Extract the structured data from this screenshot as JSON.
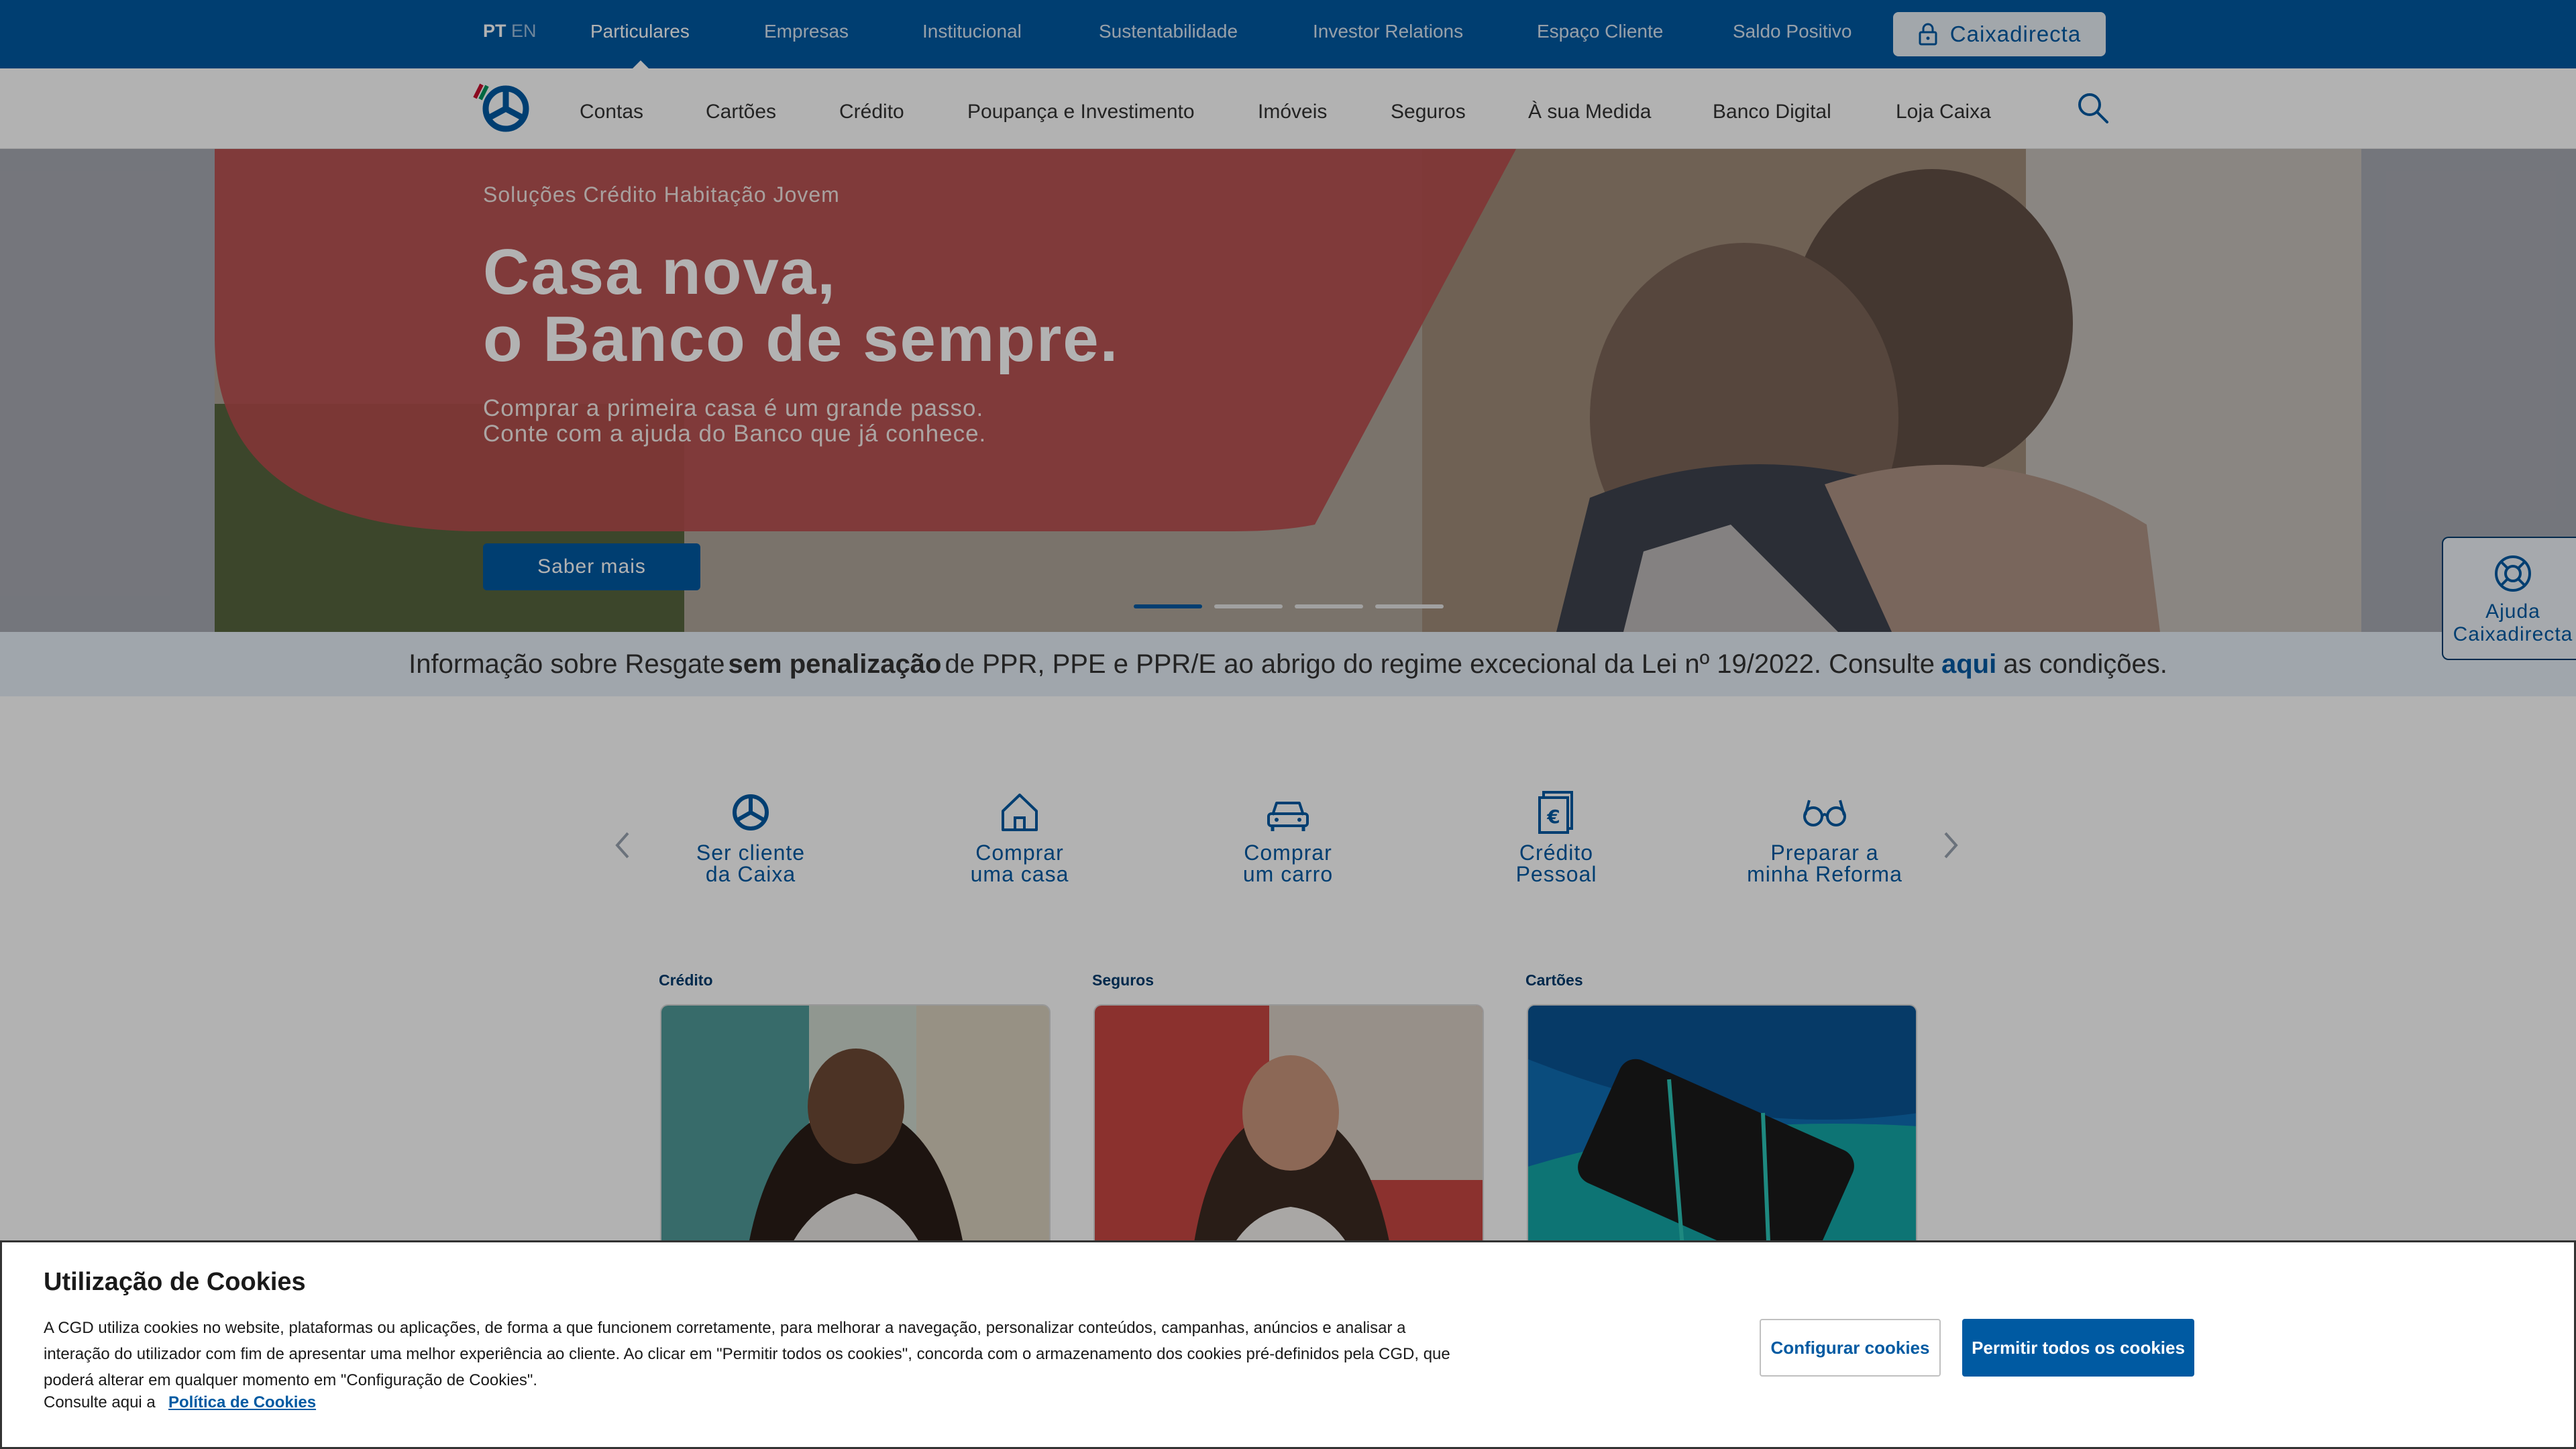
{
  "topbar": {
    "lang_pt": "PT",
    "lang_en": "EN",
    "items": [
      "Particulares",
      "Empresas",
      "Institucional",
      "Sustentabilidade",
      "Investor Relations",
      "Espaço Cliente",
      "Saldo Positivo"
    ],
    "active_item": "Particulares",
    "caixadirecta_label": "Caixadirecta",
    "caixadirecta_icon": "lock-icon"
  },
  "mainnav": {
    "logo_icon": "cgd-logo-icon",
    "items": [
      "Contas",
      "Cartões",
      "Crédito",
      "Poupança e Investimento",
      "Imóveis",
      "Seguros",
      "À sua Medida",
      "Banco Digital",
      "Loja Caixa"
    ],
    "search_icon": "search-icon"
  },
  "hero": {
    "kicker": "Soluções Crédito Habitação Jovem",
    "title_line1": "Casa nova,",
    "title_line2": "o Banco de sempre.",
    "subtitle_line1": "Comprar a primeira casa é um grande passo.",
    "subtitle_line2": "Conte com a ajuda do Banco que já conhece.",
    "button_label": "Saber mais",
    "slides_count": 4,
    "active_slide": 1
  },
  "notice": {
    "part1": "Informação sobre Resgate",
    "bold": "sem penalização",
    "part2": "de PPR, PPE e PPR/E ao abrigo do regime excecional da Lei nº 19/2022. Consulte",
    "link": "aqui",
    "part3": "as condições."
  },
  "quick_links": [
    {
      "icon": "cgd-logo-icon",
      "line1": "Ser cliente",
      "line2": "da Caixa"
    },
    {
      "icon": "house-icon",
      "line1": "Comprar",
      "line2": "uma casa"
    },
    {
      "icon": "car-icon",
      "line1": "Comprar",
      "line2": "um carro"
    },
    {
      "icon": "euro-document-icon",
      "line1": "Crédito",
      "line2": "Pessoal"
    },
    {
      "icon": "glasses-icon",
      "line1": "Preparar a",
      "line2": "minha Reforma"
    }
  ],
  "cards": [
    {
      "category": "Crédito"
    },
    {
      "category": "Seguros"
    },
    {
      "category": "Cartões"
    }
  ],
  "help_tab": {
    "icon": "lifebuoy-icon",
    "line1": "Ajuda",
    "line2": "Caixadirecta"
  },
  "cookie_banner": {
    "title": "Utilização de Cookies",
    "text": "A CGD utiliza cookies no website, plataformas ou aplicações, de forma a que funcionem corretamente, para melhorar a navegação, personalizar conteúdos, campanhas, anúncios e analisar a interação do utilizador com fim de apresentar uma melhor experiência ao cliente. Ao clicar em \"Permitir todos os cookies\", concorda com o armazenamento dos cookies pré-definidos pela CGD, que poderá alterar em qualquer momento em \"Configuração de Cookies\".",
    "consult_text": "Consulte aqui a",
    "policy_link": "Política de Cookies",
    "configure_button": "Configurar cookies",
    "allow_button": "Permitir todos os cookies"
  },
  "colors": {
    "brand_blue": "#005aa2",
    "hero_red": "#d4514f",
    "notice_bg": "#e6eef7"
  }
}
